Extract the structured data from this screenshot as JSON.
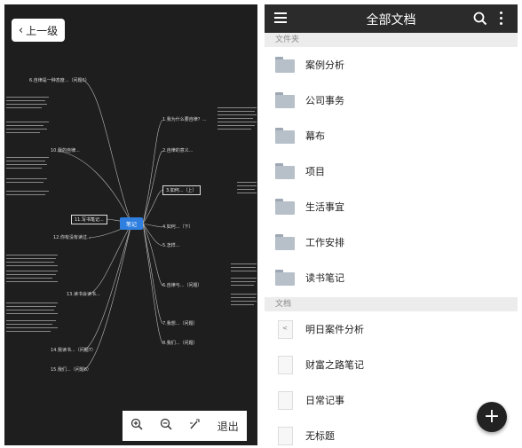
{
  "viewer": {
    "back_label": "上一级",
    "center_node": "笔记",
    "left_nodes": [
      "6.自律是一种态度...（问题6）",
      "10.我的自律...",
      "11.写书笔记...",
      "12.你有没有读过...",
      "13.读书会读书...",
      "14.我读书...（问题7）",
      "15.我们...（问题8）"
    ],
    "right_nodes": [
      "1.我为什么要自律？...",
      "2.自律的意义...",
      "3.如何...（上）",
      "4.如何...（下）",
      "5.怎样...",
      "6.自律与...（问题）",
      "7.我想...（问题）",
      "8.我们...（问题）"
    ],
    "zoom": {
      "exit_label": "退出"
    }
  },
  "docs": {
    "title": "全部文档",
    "folders_header": "文件夹",
    "folders": [
      "案例分析",
      "公司事务",
      "幕布",
      "项目",
      "生活事宜",
      "工作安排",
      "读书笔记"
    ],
    "documents_header": "文档",
    "documents": [
      "明日案件分析",
      "财富之路笔记",
      "日常记事",
      "无标题"
    ]
  },
  "colors": {
    "viewer_bg": "#1e1e1e",
    "center_node": "#2f7fe0",
    "topbar": "#2b2b2b",
    "fab": "#222222"
  },
  "icons": [
    "back-chevron-icon",
    "zoom-in-icon",
    "zoom-out-icon",
    "fit-icon",
    "menu-icon",
    "search-icon",
    "more-icon",
    "folder-icon",
    "document-icon",
    "share-icon",
    "add-icon"
  ]
}
